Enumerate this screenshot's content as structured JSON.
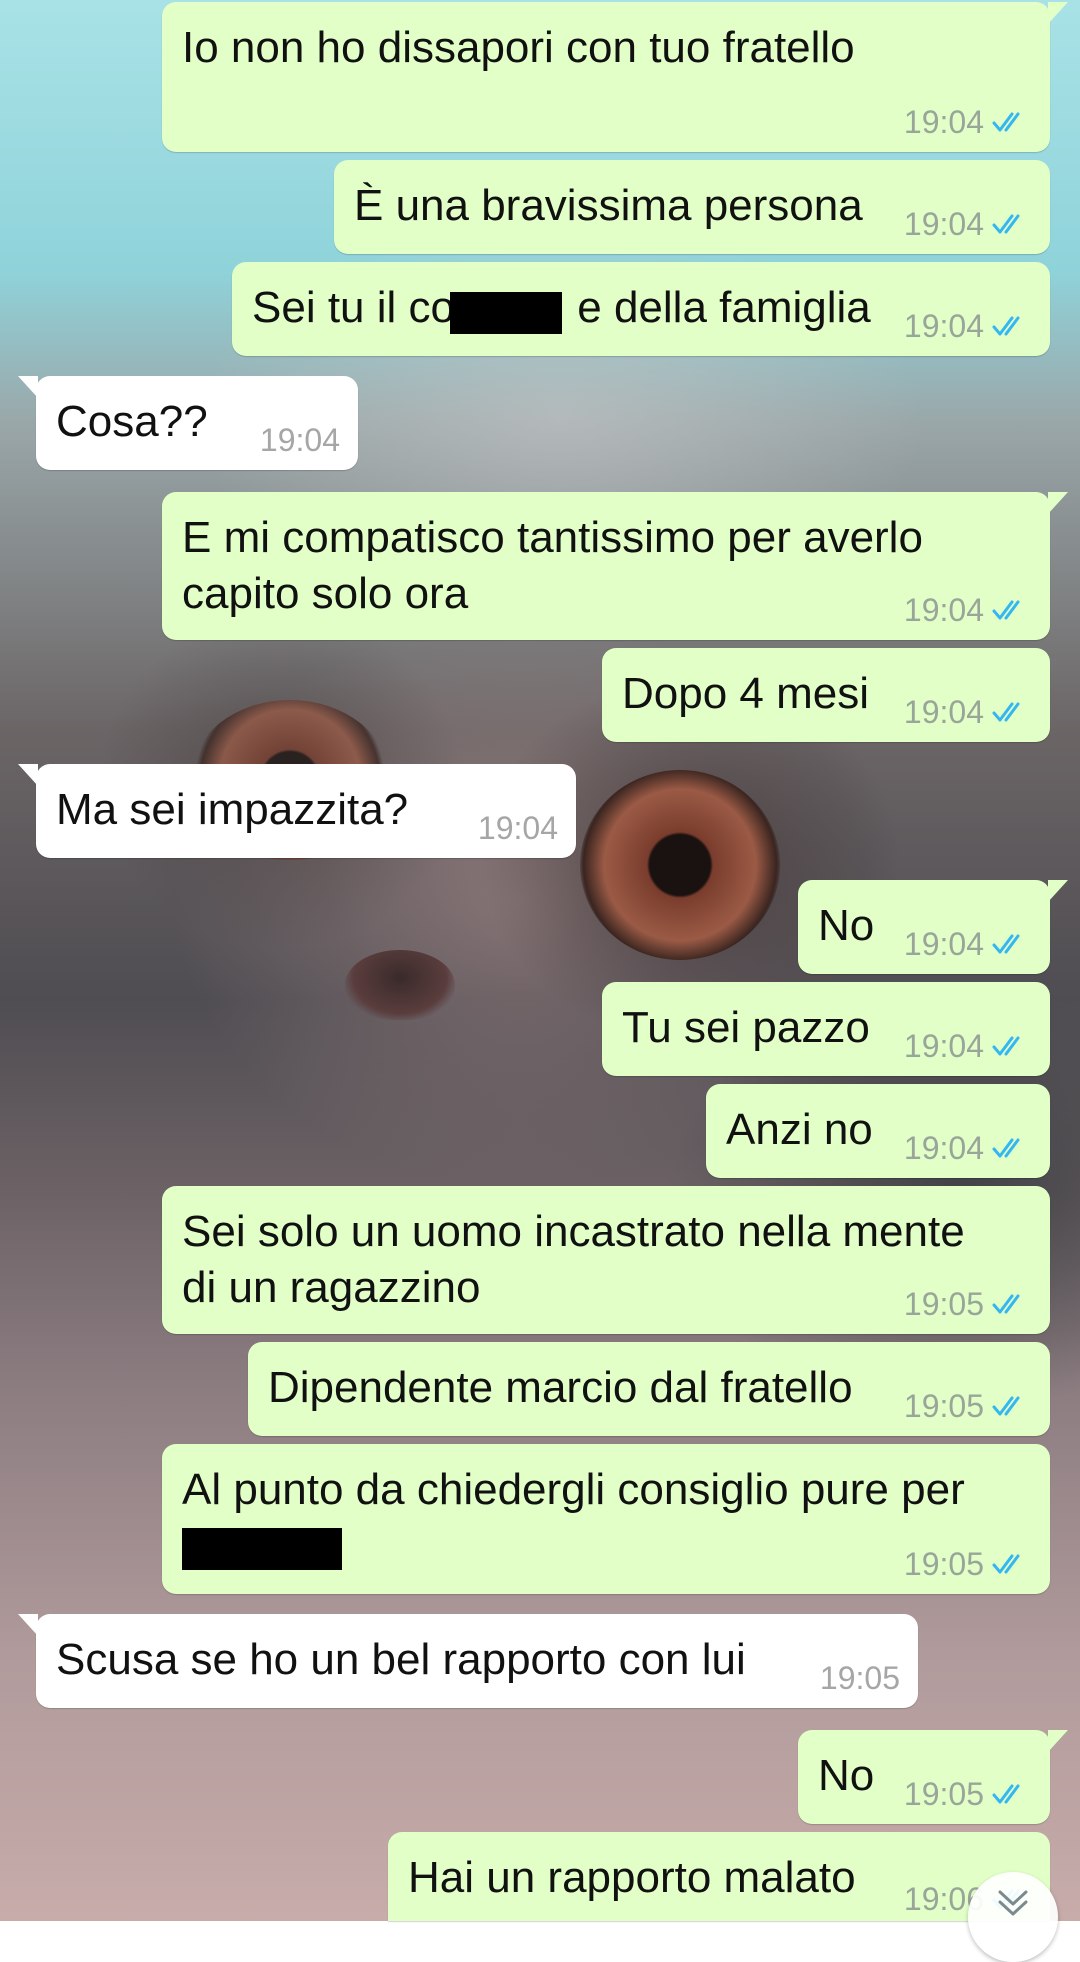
{
  "colors": {
    "outgoing_bubble": "#e1ffc7",
    "incoming_bubble": "#ffffff",
    "read_ticks": "#34b7f1",
    "timestamp": "#9aa59a"
  },
  "messages": [
    {
      "direction": "outgoing",
      "text": "Io non ho dissapori con tuo fratello",
      "time": "19:04",
      "status": "read"
    },
    {
      "direction": "outgoing",
      "text": "È una bravissima persona",
      "time": "19:04",
      "status": "read"
    },
    {
      "direction": "outgoing",
      "text": "Sei tu il cog        e della famiglia",
      "time": "19:04",
      "status": "read"
    },
    {
      "direction": "incoming",
      "text": "Cosa??",
      "time": "19:04"
    },
    {
      "direction": "outgoing",
      "text": "E mi compatisco tantissimo per averlo\ncapito solo ora",
      "time": "19:04",
      "status": "read"
    },
    {
      "direction": "outgoing",
      "text": "Dopo 4 mesi",
      "time": "19:04",
      "status": "read"
    },
    {
      "direction": "incoming",
      "text": "Ma sei impazzita?",
      "time": "19:04"
    },
    {
      "direction": "outgoing",
      "text": "No",
      "time": "19:04",
      "status": "read"
    },
    {
      "direction": "outgoing",
      "text": "Tu sei pazzo",
      "time": "19:04",
      "status": "read"
    },
    {
      "direction": "outgoing",
      "text": "Anzi no",
      "time": "19:04",
      "status": "read"
    },
    {
      "direction": "outgoing",
      "text": "Sei solo un uomo incastrato nella mente\ndi un ragazzino",
      "time": "19:05",
      "status": "read"
    },
    {
      "direction": "outgoing",
      "text": "Dipendente marcio dal fratello",
      "time": "19:05",
      "status": "read"
    },
    {
      "direction": "outgoing",
      "text": "Al punto da chiedergli consiglio pure per",
      "time": "19:05",
      "status": "read"
    },
    {
      "direction": "incoming",
      "text": "Scusa se ho un bel rapporto con lui",
      "time": "19:05"
    },
    {
      "direction": "outgoing",
      "text": "No",
      "time": "19:05",
      "status": "read"
    },
    {
      "direction": "outgoing",
      "text": "Hai un rapporto malato",
      "time": "19:06",
      "status": "read"
    }
  ],
  "scroll_button_icon": "chevron-down-icon"
}
